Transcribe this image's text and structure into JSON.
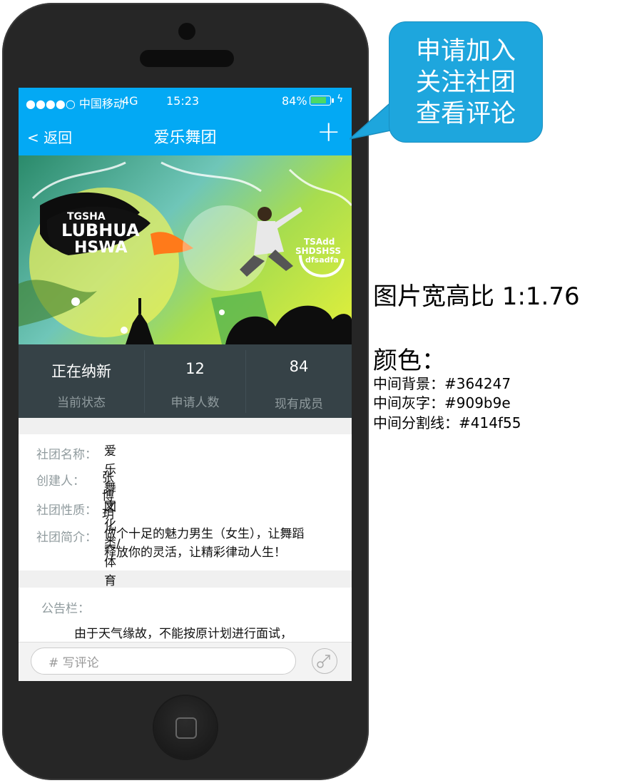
{
  "status_bar": {
    "carrier": "●●●●○ 中国移动",
    "network": "4G",
    "time": "15:23",
    "battery": "84%",
    "battery_level": 0.84
  },
  "nav": {
    "back_label": "< 返回",
    "title": "爱乐舞团",
    "add_icon": "plus-icon"
  },
  "banner": {
    "logo_line1": "TGSHA",
    "logo_line2": "LUBHUA",
    "logo_line3": "HSWA",
    "tag_line1": "TSAdd",
    "tag_line2": "SHDSHSS",
    "tag_line3": "dfsadfa"
  },
  "stats": [
    {
      "value": "正在纳新",
      "label": "当前状态"
    },
    {
      "value": "12",
      "label": "申请人数"
    },
    {
      "value": "84",
      "label": "现有成员"
    }
  ],
  "info": {
    "name_key": "社团名称：",
    "name_val": "爱乐舞团",
    "creator_key": "创建人：",
    "creator_val": "张博玥",
    "type_key": "社团性质：",
    "type_val": "文化类/体育类/艺术类",
    "intro_key": "社团简介：",
    "intro_line1": "做个十足的魅力男生（女生），让舞蹈",
    "intro_line2": "释放你的灵活，让精彩律动人生！"
  },
  "notice": {
    "title": "公告栏：",
    "text": "由于天气缘故，不能按原计划进行面试，"
  },
  "comment": {
    "placeholder": "#  写评论",
    "share_icon": "share-icon"
  },
  "callout": {
    "line1": "申请加入",
    "line2": "关注社团",
    "line3": "查看评论"
  },
  "side_notes": {
    "ratio": "图片宽高比 1:1.76",
    "colors_title": "颜色：",
    "color1": "中间背景：#364247",
    "color2": "中间灰字：#909b9e",
    "color3": "中间分割线：#414f55"
  },
  "colors": {
    "primary": "#03a9f4",
    "stats_bg": "#364247",
    "gray_text": "#909b9e",
    "divider": "#414f55",
    "callout": "#1ea6dd"
  }
}
